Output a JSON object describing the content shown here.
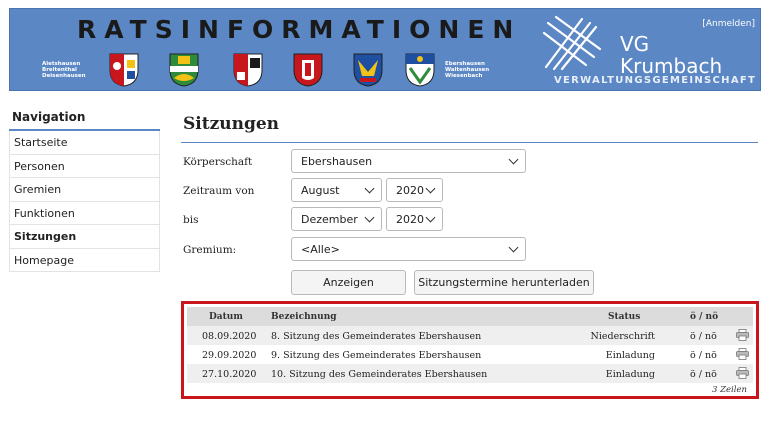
{
  "banner": {
    "title": "RATSINFORMATIONEN",
    "municipalities_left": [
      "Aletshausen",
      "Breitenthal",
      "Deisenhausen"
    ],
    "municipalities_right": [
      "Ebershausen",
      "Waltenhausen",
      "Wiesenbach"
    ],
    "vg_line1": "VG",
    "vg_line2": "Krumbach",
    "vg_sub": "VERWALTUNGSGEMEINSCHAFT",
    "login": "[Anmelden]"
  },
  "navigation": {
    "heading": "Navigation",
    "items": [
      "Startseite",
      "Personen",
      "Gremien",
      "Funktionen",
      "Sitzungen",
      "Homepage"
    ],
    "active": "Sitzungen"
  },
  "main": {
    "title": "Sitzungen",
    "form": {
      "koerperschaft_label": "Körperschaft",
      "koerperschaft_value": "Ebershausen",
      "zeitraum_von_label": "Zeitraum von",
      "von_month": "August",
      "von_year": "2020",
      "bis_label": "bis",
      "bis_month": "Dezember",
      "bis_year": "2020",
      "gremium_label": "Gremium:",
      "gremium_value": "<Alle>"
    },
    "buttons": {
      "show": "Anzeigen",
      "download": "Sitzungstermine herunterladen"
    },
    "table": {
      "headers": {
        "datum": "Datum",
        "bezeichnung": "Bezeichnung",
        "status": "Status",
        "onoe": "ö / nö"
      },
      "rows": [
        {
          "datum": "08.09.2020",
          "bezeichnung": "8. Sitzung des Gemeinderates Ebershausen",
          "status": "Niederschrift",
          "onoe": "ö / nö"
        },
        {
          "datum": "29.09.2020",
          "bezeichnung": "9. Sitzung des Gemeinderates Ebershausen",
          "status": "Einladung",
          "onoe": "ö / nö"
        },
        {
          "datum": "27.10.2020",
          "bezeichnung": "10. Sitzung des Gemeinderates Ebershausen",
          "status": "Einladung",
          "onoe": "ö / nö"
        }
      ],
      "count": "3 Zeilen"
    }
  },
  "colors": {
    "banner": "#5b87c5",
    "highlight_border": "#c8161d",
    "header_row": "#dcdcdc"
  },
  "icons": {
    "row_action": "printer-icon",
    "select_arrow": "chevron-down-icon"
  }
}
